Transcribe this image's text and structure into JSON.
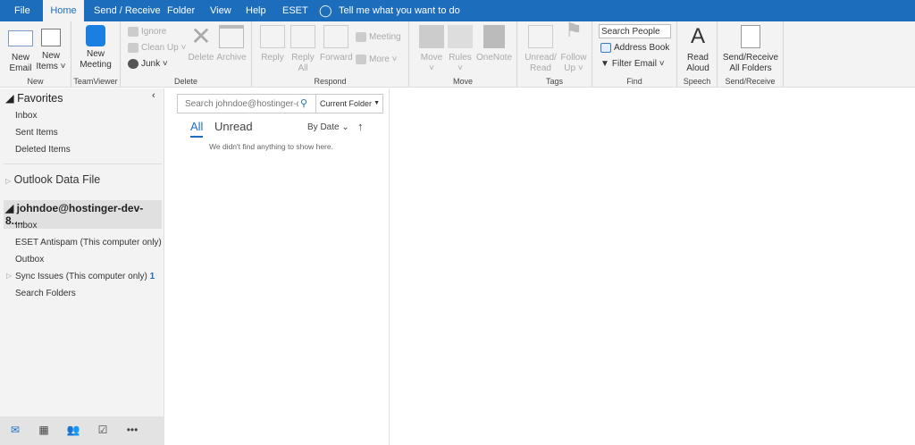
{
  "tabs": [
    "File",
    "Home",
    "Send / Receive",
    "Folder",
    "View",
    "Help",
    "ESET"
  ],
  "tell_me": "Tell me what you want to do",
  "ribbon": {
    "new": {
      "label": "New",
      "new_email": "New Email",
      "new_items": "New Items"
    },
    "teamviewer": {
      "label": "TeamViewer",
      "new_meeting": "New Meeting"
    },
    "delete": {
      "label": "Delete",
      "ignore": "Ignore",
      "clean_up": "Clean Up",
      "junk": "Junk",
      "delete": "Delete",
      "archive": "Archive"
    },
    "respond": {
      "label": "Respond",
      "reply": "Reply",
      "reply_all": "Reply All",
      "forward": "Forward",
      "meeting": "Meeting",
      "more": "More"
    },
    "move": {
      "label": "Move",
      "move": "Move",
      "rules": "Rules",
      "onenote": "OneNote"
    },
    "tags": {
      "label": "Tags",
      "unread_read": "Unread/ Read",
      "follow_up": "Follow Up"
    },
    "find": {
      "label": "Find",
      "search_people": "Search People",
      "address_book": "Address Book",
      "filter_email": "Filter Email"
    },
    "speech": {
      "label": "Speech",
      "read_aloud": "Read Aloud"
    },
    "sendreceive": {
      "label": "Send/Receive",
      "all_folders": "Send/Receive All Folders"
    }
  },
  "folders": {
    "favorites": "Favorites",
    "fav_items": [
      "Inbox",
      "Sent Items",
      "Deleted Items"
    ],
    "data_file": "Outlook Data File",
    "account": "johndoe@hostinger-dev-8....",
    "account_items": [
      "Inbox",
      "ESET Antispam (This computer only)",
      "Outbox",
      "Sync Issues (This computer only)",
      "Search Folders"
    ],
    "sync_count": "1"
  },
  "list": {
    "search_placeholder": "Search johndoe@hostinger-c",
    "scope": "Current Folder",
    "filter_all": "All",
    "filter_unread": "Unread",
    "sort": "By Date",
    "empty": "We didn't find anything to show here."
  },
  "colors": {
    "accent": "#1c6ebd"
  }
}
